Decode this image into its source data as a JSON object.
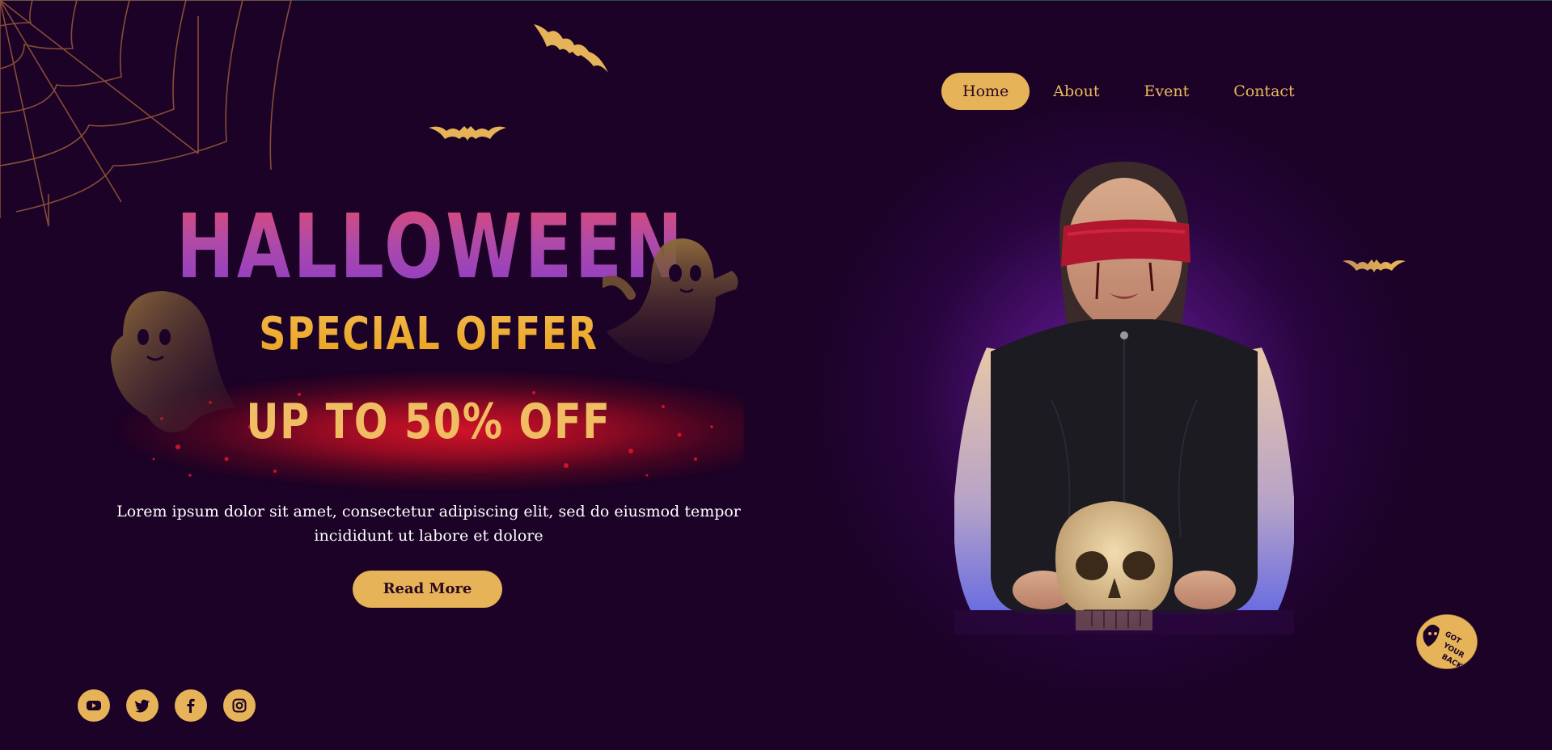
{
  "nav": {
    "items": [
      {
        "label": "Home",
        "active": true
      },
      {
        "label": "About",
        "active": false
      },
      {
        "label": "Event",
        "active": false
      },
      {
        "label": "Contact",
        "active": false
      }
    ]
  },
  "hero": {
    "title": "HALLOWEEN",
    "subtitle": "SPECIAL OFFER",
    "offer": "UP TO 50% OFF",
    "description": "Lorem ipsum dolor sit amet, consectetur adipiscing elit, sed do eiusmod tempor incididunt ut labore et dolore",
    "button_label": "Read More"
  },
  "socials": [
    {
      "name": "youtube-icon"
    },
    {
      "name": "twitter-icon"
    },
    {
      "name": "facebook-icon"
    },
    {
      "name": "instagram-icon"
    }
  ],
  "badge_text": "GOT YOUR BACK",
  "colors": {
    "background": "#1b0226",
    "accent": "#e6b358",
    "title_gradient_top": "#e24b6e",
    "title_gradient_bottom": "#8a3cc9",
    "subtitle": "#e8a21d",
    "splash": "#d3142c"
  }
}
